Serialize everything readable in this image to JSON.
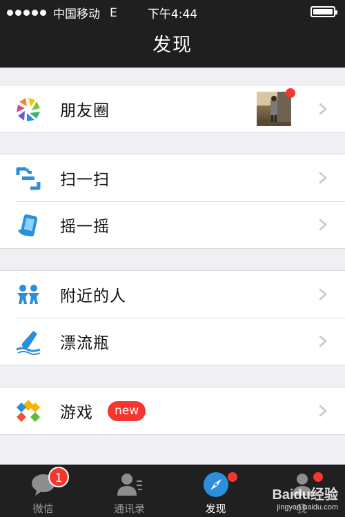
{
  "status_bar": {
    "carrier": "中国移动",
    "network": "E",
    "time": "下午4:44"
  },
  "nav": {
    "title": "发现"
  },
  "groups": [
    {
      "items": [
        {
          "label": "朋友圈",
          "icon": "moments-icon",
          "has_thumbnail": true,
          "unread_dot": true
        }
      ]
    },
    {
      "items": [
        {
          "label": "扫一扫",
          "icon": "scan-icon"
        },
        {
          "label": "摇一摇",
          "icon": "shake-icon"
        }
      ]
    },
    {
      "items": [
        {
          "label": "附近的人",
          "icon": "people-nearby-icon"
        },
        {
          "label": "漂流瓶",
          "icon": "drift-bottle-icon"
        }
      ]
    },
    {
      "items": [
        {
          "label": "游戏",
          "icon": "games-icon",
          "badge": "new"
        }
      ]
    }
  ],
  "tab_bar": {
    "tabs": [
      {
        "label": "微信",
        "icon": "chat-bubble-icon",
        "badge_count": "1"
      },
      {
        "label": "通讯录",
        "icon": "contacts-icon"
      },
      {
        "label": "发现",
        "icon": "compass-icon",
        "active": true,
        "dot": true
      },
      {
        "label": "我",
        "icon": "profile-icon",
        "dot": true
      }
    ]
  },
  "watermark": {
    "line1": "Baidu经验",
    "line2": "jingyan.baidu.com"
  },
  "colors": {
    "bar_bg": "#1f1f1f",
    "badge_red": "#f43530",
    "accent_blue": "#2a8fdc",
    "page_bg": "#efeff4"
  }
}
